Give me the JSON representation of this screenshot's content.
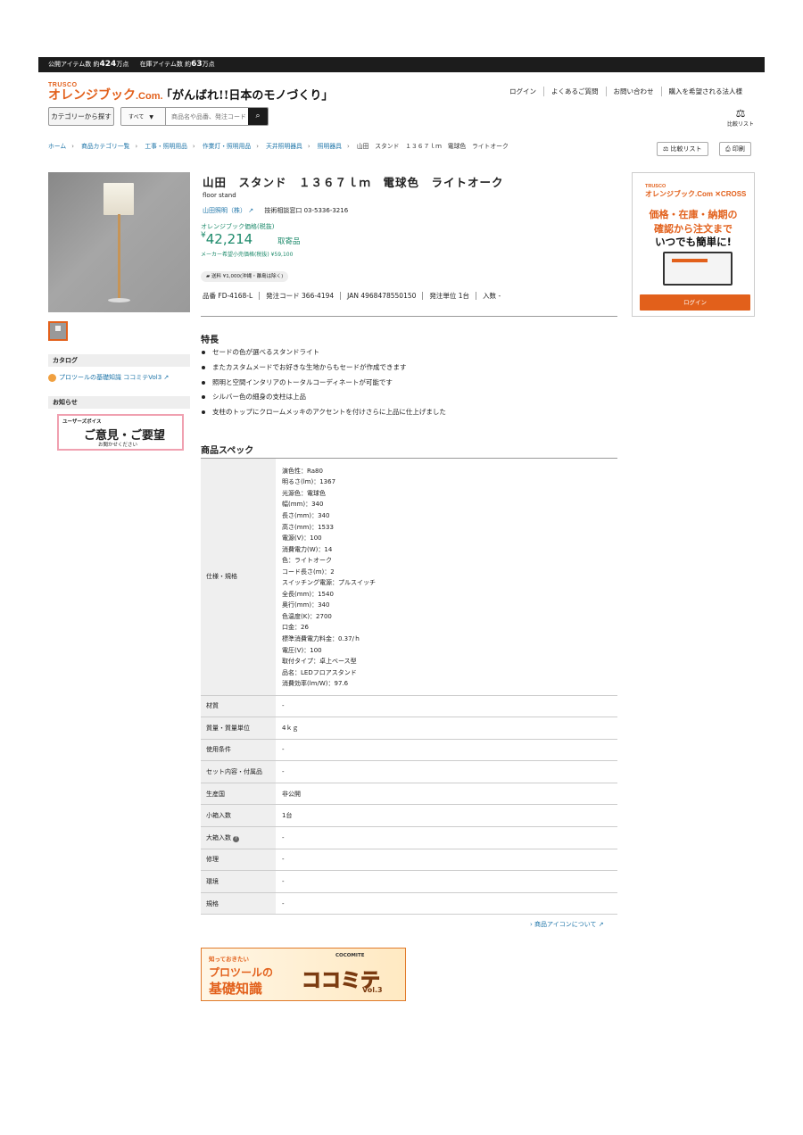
{
  "topbar": {
    "public_label": "公開アイテム数 約",
    "public_count": "424",
    "public_unit": "万点",
    "stock_label": "在庫アイテム数 約",
    "stock_count": "63",
    "stock_unit": "万点"
  },
  "header": {
    "logo_small": "TRUSCO",
    "logo_main": "オレンジブック",
    "logo_com": ".Com.",
    "tagline": "「がんばれ!!日本のモノづくり」",
    "nav": [
      "ログイン",
      "よくあるご質問",
      "お問い合わせ",
      "購入を希望される法人様"
    ],
    "category_button": "カテゴリーから探す",
    "search_scope": "すべて",
    "search_placeholder": "商品名や品番、発注コード",
    "compare_list": "比較リスト"
  },
  "breadcrumb": [
    "ホーム",
    "商品カテゴリ一覧",
    "工事・照明用品",
    "作業灯・照明用品",
    "天井照明器具",
    "照明器具",
    "山田　スタンド　１３６７ｌｍ　電球色　ライトオーク"
  ],
  "toolbar": {
    "compare": "比較リスト",
    "print": "印刷"
  },
  "product": {
    "title": "山田　スタンド　１３６７ｌｍ　電球色　ライトオーク",
    "subtitle": "floor stand",
    "maker": "山田照明（株）",
    "tech_contact": "技術相談窓口 03-5336-3216",
    "price_label": "オレンジブック価格(税抜)",
    "price_symbol": "¥",
    "price": "42,214",
    "order_type": "取寄品",
    "msrp": "メーカー希望小売価格(税抜) ¥59,100",
    "shipping": "送料 ¥1,000(沖縄・離島は除く)",
    "codes": [
      "品番 FD-4168-L",
      "発注コード 366-4194",
      "JAN 4968478550150",
      "発注単位 1台",
      "入数 -"
    ]
  },
  "sidebar": {
    "catalog_heading": "カタログ",
    "catalog_link": "プロツールの基礎知識 ココミテVol3",
    "news_heading": "お知らせ",
    "voice_small": "ユーザーズボイス",
    "voice_main": "ご意見・ご要望",
    "voice_sub": "お聞かせください"
  },
  "features": {
    "heading": "特長",
    "items": [
      "セードの色が選べるスタンドライト",
      "またカスタムメードでお好きな生地からもセードが作成できます",
      "照明と空間インタリアのトータルコーディネートが可能です",
      "シルバー色の細身の支柱は上品",
      "支柱のトップにクロームメッキのアクセントを付けさらに上品に仕上げました"
    ]
  },
  "specs": {
    "heading": "商品スペック",
    "spec_label": "仕様・規格",
    "spec_lines": [
      "演色性：Ra80",
      "明るさ(lm)：1367",
      "光源色：電球色",
      "幅(mm)：340",
      "長さ(mm)：340",
      "高さ(mm)：1533",
      "電源(V)：100",
      "消費電力(W)：14",
      "色：ライトオーク",
      "コード長さ(m)：2",
      "スイッチング電源：プルスイッチ",
      "全長(mm)：1540",
      "奥行(mm)：340",
      "色温度(K)：2700",
      "口金：26",
      "標準消費電力料金：0.37/ｈ",
      "電圧(V)：100",
      "取付タイプ：卓上ベース型",
      "品名：LEDフロアスタンド",
      "消費効率(lm/W)：97.6"
    ],
    "rows": [
      {
        "label": "材質",
        "value": "-"
      },
      {
        "label": "質量・質量単位",
        "value": "4ｋｇ"
      },
      {
        "label": "使用条件",
        "value": "-"
      },
      {
        "label": "セット内容・付属品",
        "value": "-"
      },
      {
        "label": "生産国",
        "value": "非公開"
      },
      {
        "label": "小箱入数",
        "value": "1台"
      },
      {
        "label": "大箱入数",
        "value": "-"
      },
      {
        "label": "修理",
        "value": "-"
      },
      {
        "label": "環境",
        "value": "-"
      },
      {
        "label": "規格",
        "value": "-"
      }
    ],
    "help_glyph": "?",
    "icon_link": "商品アイコンについて"
  },
  "banner": {
    "line1": "知っておきたい",
    "line2": "プロツールの",
    "line3": "基礎知識",
    "brand": "ココミテ",
    "vol": "Vol.3",
    "tag": "COCOMITE"
  },
  "ad": {
    "small": "TRUSCO",
    "brand": "オレンジブック.Com ✕CROSS",
    "line1": "価格・在庫・納期の",
    "line2": "確認から注文まで",
    "line3": "いつでも簡単に!",
    "button": "ログイン"
  }
}
